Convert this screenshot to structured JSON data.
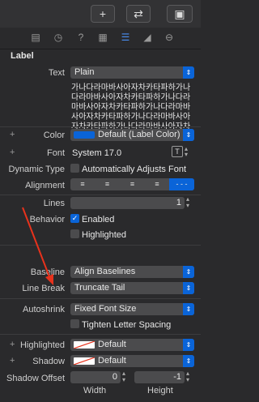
{
  "toolbar": {
    "add_icon": "+",
    "swap_icon": "⇄",
    "panel_icon": "▣"
  },
  "tabs": [
    "file-inspector",
    "history",
    "help",
    "identity",
    "attributes",
    "size",
    "connections"
  ],
  "section": {
    "title": "Label"
  },
  "text": {
    "label": "Text",
    "value": "Plain"
  },
  "body_text": "가나다라마바사아자차카타파하가나다라마바사아자차카타파하가나다라마바사아자차카타파하가나다라마바사아자차카타파하가나다라마바사아자차카타파하가나다라마바사아자차카타파하",
  "color": {
    "label": "Color",
    "value": "Default (Label Color)",
    "swatch": "#0a64d8"
  },
  "font": {
    "label": "Font",
    "value": "System 17.0"
  },
  "dynamic_type": {
    "label": "Dynamic Type",
    "value": "Automatically Adjusts Font"
  },
  "alignment": {
    "label": "Alignment"
  },
  "lines": {
    "label": "Lines",
    "value": "1"
  },
  "behavior": {
    "label": "Behavior",
    "enabled": "Enabled",
    "highlighted": "Highlighted"
  },
  "baseline": {
    "label": "Baseline",
    "value": "Align Baselines"
  },
  "line_break": {
    "label": "Line Break",
    "value": "Truncate Tail"
  },
  "autoshrink": {
    "label": "Autoshrink",
    "value": "Fixed Font Size",
    "tighten": "Tighten Letter Spacing"
  },
  "highlighted": {
    "label": "Highlighted",
    "value": "Default"
  },
  "shadow": {
    "label": "Shadow",
    "value": "Default"
  },
  "shadow_offset": {
    "label": "Shadow Offset",
    "width": "0",
    "height": "-1",
    "width_label": "Width",
    "height_label": "Height"
  },
  "annotation": {
    "arrow_color": "#e8321c"
  }
}
